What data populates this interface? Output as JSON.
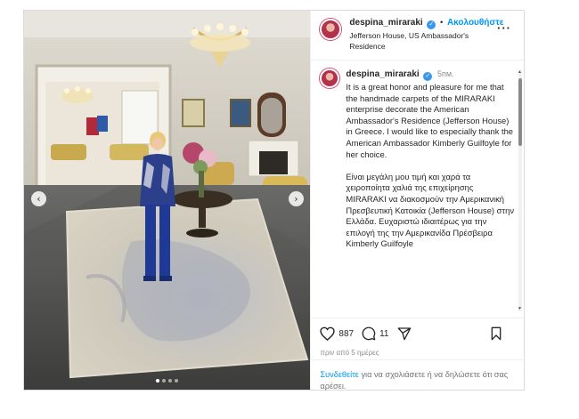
{
  "post": {
    "username": "despina_miraraki",
    "follow_label": "Ακολουθήστε",
    "separator": "•",
    "location": "Jefferson House, US Ambassador's Residence",
    "more_icon": "more-horizontal-icon",
    "verified_icon": "verified-badge-icon"
  },
  "media": {
    "carousel_dots": 4,
    "active_dot": 1,
    "prev_icon": "chevron-left-icon",
    "next_icon": "chevron-right-icon"
  },
  "caption": {
    "username": "despina_miraraki",
    "time": "5пм.",
    "text": "It is a great honor and pleasure for me that the handmade carpets of the MIRARAKI enterprise decorate the American Ambassador's Residence (Jefferson House) in Greece. I would like to especially thank the American Ambassador Kimberly Guilfoyle for her choice.\n\nΕίναι μεγάλη μου τιμή και χαρά τα χειροποίητα χαλιά της επιχείρησης MIRARAKI να διακοσμούν την Αμερικανική Πρεσβευτική Κατοικία (Jefferson House) στην Ελλάδα. Ευχαριστώ ιδιαιτέρως για την επιλογή της την Αμερικανίδα Πρέσβειρα Kimberly Guilfoyle"
  },
  "actions": {
    "like_count": "887",
    "comment_count": "11",
    "like_icon": "heart-icon",
    "comment_icon": "comment-icon",
    "share_icon": "share-icon",
    "save_icon": "bookmark-icon",
    "add_comment_icon": "plus-circle-icon"
  },
  "date": "πριν από 5 ημέρες",
  "login": {
    "link": "Συνδεθείτε",
    "text": " για να σχολιάσετε ή να δηλώσετε ότι σας αρέσει."
  },
  "colors": {
    "link_blue": "#0095f6",
    "verified_blue": "#3897f0",
    "text": "#262626",
    "muted": "#8e8e8e",
    "border": "#dbdbdb"
  }
}
